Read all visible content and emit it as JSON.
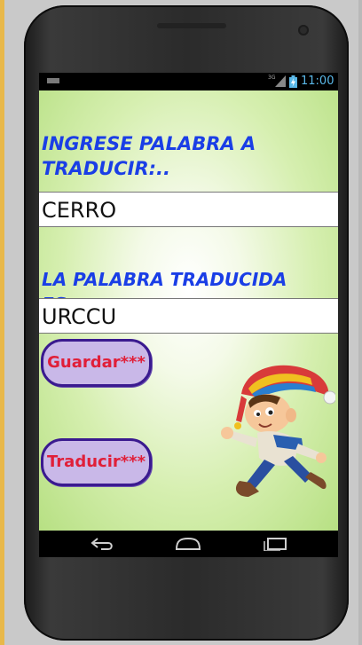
{
  "status": {
    "network": "3G",
    "time": "11:00"
  },
  "app": {
    "input_label": "INGRESE PALABRA A TRADUCIR:..",
    "input_value": "CERRO",
    "output_label": "LA PALABRA TRADUCIDA ES:..",
    "output_value": "URCCU",
    "save_button": "Guardar***",
    "translate_button": "Traducir***"
  },
  "nav": {
    "back": "back-icon",
    "home": "home-icon",
    "recents": "recents-icon"
  },
  "colors": {
    "label": "#1a3ee6",
    "button_text": "#e01f39",
    "button_fill": "#c9b8e8",
    "button_border": "#3a1a8f",
    "background": "#b7e083"
  }
}
